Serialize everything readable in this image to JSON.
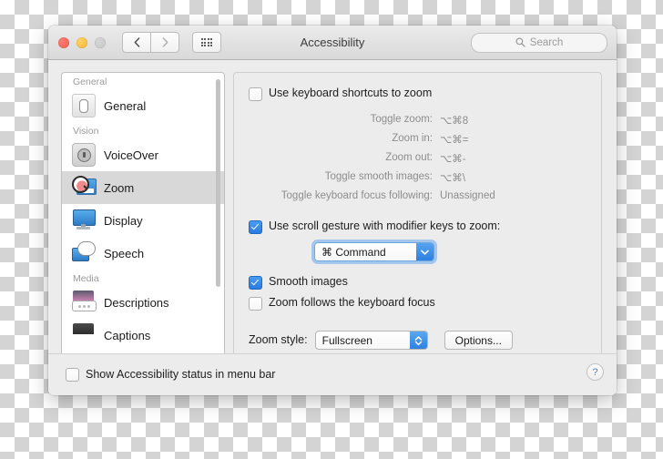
{
  "window": {
    "title": "Accessibility",
    "traffic_lights": [
      "close",
      "minimize",
      "zoom"
    ],
    "nav_back": "back-chevron",
    "nav_forward": "forward-chevron",
    "show_all": "grid-icon",
    "search_placeholder": "Search"
  },
  "sidebar": {
    "groups": [
      {
        "label": "General",
        "items": [
          {
            "label": "General",
            "icon": "general-switch-icon",
            "selected": false
          }
        ]
      },
      {
        "label": "Vision",
        "items": [
          {
            "label": "VoiceOver",
            "icon": "voiceover-icon",
            "selected": false
          },
          {
            "label": "Zoom",
            "icon": "zoom-magnifier-icon",
            "selected": true
          },
          {
            "label": "Display",
            "icon": "display-monitor-icon",
            "selected": false
          },
          {
            "label": "Speech",
            "icon": "speech-bubble-icon",
            "selected": false
          }
        ]
      },
      {
        "label": "Media",
        "items": [
          {
            "label": "Descriptions",
            "icon": "descriptions-icon",
            "selected": false
          },
          {
            "label": "Captions",
            "icon": "captions-icon",
            "selected": false
          }
        ]
      }
    ]
  },
  "content": {
    "keyboard_shortcuts": {
      "label": "Use keyboard shortcuts to zoom",
      "checked": false,
      "rows": [
        {
          "label": "Toggle zoom:",
          "value": "⌥⌘8"
        },
        {
          "label": "Zoom in:",
          "value": "⌥⌘="
        },
        {
          "label": "Zoom out:",
          "value": "⌥⌘-"
        },
        {
          "label": "Toggle smooth images:",
          "value": "⌥⌘\\"
        },
        {
          "label": "Toggle keyboard focus following:",
          "value": "Unassigned"
        }
      ]
    },
    "scroll_gesture": {
      "label": "Use scroll gesture with modifier keys to zoom:",
      "checked": true,
      "modifier_value": "⌘ Command",
      "focused": true
    },
    "smooth_images": {
      "label": "Smooth images",
      "checked": true
    },
    "zoom_follows_focus": {
      "label": "Zoom follows the keyboard focus",
      "checked": false
    },
    "zoom_style": {
      "label": "Zoom style:",
      "value": "Fullscreen",
      "options_button": "Options..."
    }
  },
  "bottom": {
    "show_status_label": "Show Accessibility status in menu bar",
    "show_status_checked": false,
    "help": "?"
  },
  "colors": {
    "accent": "#2f7fe0",
    "selected_row": "#d8d8d8",
    "muted_text": "#8d8d8d"
  }
}
